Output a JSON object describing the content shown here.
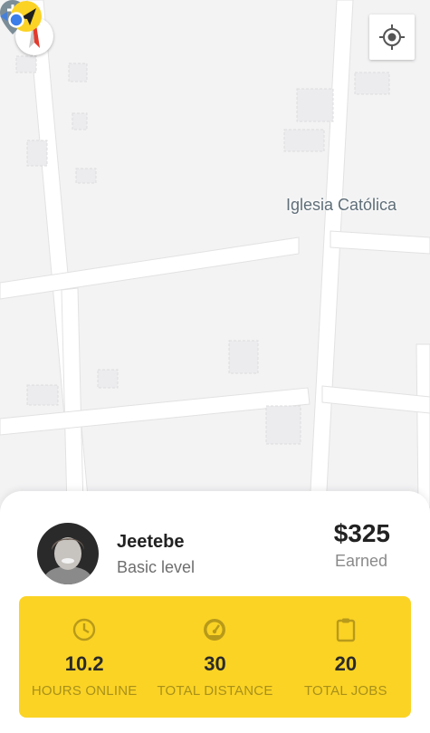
{
  "map": {
    "poi_label": "Iglesia Católica"
  },
  "icons": {
    "compass": "compass-icon",
    "locate": "my-location-icon",
    "poi": "church-pin-icon",
    "driver": "navigation-arrow-icon"
  },
  "colors": {
    "accent": "#fbd325",
    "user_dot": "#3b7de9"
  },
  "driver": {
    "name": "Jeetebe",
    "level": "Basic level",
    "earned_amount": "$325",
    "earned_label": "Earned"
  },
  "stats": [
    {
      "icon": "clock-icon",
      "value": "10.2",
      "label": "HOURS ONLINE"
    },
    {
      "icon": "speedometer-icon",
      "value": "30",
      "label": "TOTAL DISTANCE"
    },
    {
      "icon": "clipboard-icon",
      "value": "20",
      "label": "TOTAL JOBS"
    }
  ]
}
